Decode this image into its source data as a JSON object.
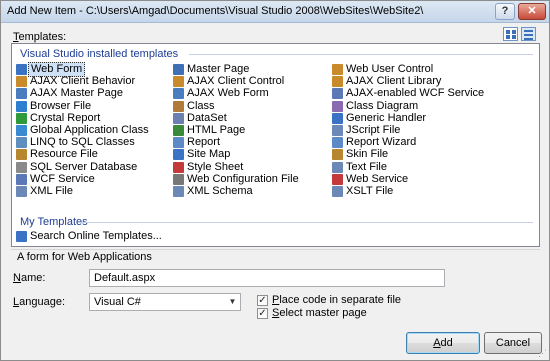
{
  "window": {
    "title": "Add New Item - C:\\Users\\Amgad\\Documents\\Visual Studio 2008\\WebSites\\WebSite2\\"
  },
  "title_buttons": {
    "help": "?",
    "close": "✕"
  },
  "templates_label_prefix": "T",
  "templates_label_rest": "emplates:",
  "groups": {
    "installed": "Visual Studio installed templates",
    "my": "My Templates"
  },
  "installed_templates": [
    {
      "label": "Web Form",
      "icon": "web-form-icon",
      "color": "#3a72c4",
      "selected": true
    },
    {
      "label": "AJAX Client Behavior",
      "icon": "ajax-behavior-icon",
      "color": "#c98a2b"
    },
    {
      "label": "AJAX Master Page",
      "icon": "ajax-master-page-icon",
      "color": "#4a7cc0"
    },
    {
      "label": "Browser File",
      "icon": "browser-file-icon",
      "color": "#2f7fd0"
    },
    {
      "label": "Crystal Report",
      "icon": "crystal-report-icon",
      "color": "#2f9a3a"
    },
    {
      "label": "Global Application Class",
      "icon": "global-class-icon",
      "color": "#3a8ad1"
    },
    {
      "label": "LINQ to SQL Classes",
      "icon": "linq-icon",
      "color": "#5e8fbe"
    },
    {
      "label": "Resource File",
      "icon": "resource-file-icon",
      "color": "#b8862f"
    },
    {
      "label": "SQL Server Database",
      "icon": "database-icon",
      "color": "#8a8a8a"
    },
    {
      "label": "WCF Service",
      "icon": "wcf-service-icon",
      "color": "#5b79b6"
    },
    {
      "label": "XML File",
      "icon": "xml-file-icon",
      "color": "#6b88b6"
    },
    {
      "label": "Master Page",
      "icon": "master-page-icon",
      "color": "#3f6fb4"
    },
    {
      "label": "AJAX Client Control",
      "icon": "ajax-control-icon",
      "color": "#c98a2b"
    },
    {
      "label": "AJAX Web Form",
      "icon": "ajax-web-form-icon",
      "color": "#4a7cc0"
    },
    {
      "label": "Class",
      "icon": "class-icon",
      "color": "#b07a3a"
    },
    {
      "label": "DataSet",
      "icon": "dataset-icon",
      "color": "#6b7fb0"
    },
    {
      "label": "HTML Page",
      "icon": "html-page-icon",
      "color": "#3b8a3b"
    },
    {
      "label": "Report",
      "icon": "report-icon",
      "color": "#5b8ac6"
    },
    {
      "label": "Site Map",
      "icon": "site-map-icon",
      "color": "#3a72c4"
    },
    {
      "label": "Style Sheet",
      "icon": "style-sheet-icon",
      "color": "#c43a3a"
    },
    {
      "label": "Web Configuration File",
      "icon": "web-config-icon",
      "color": "#777777"
    },
    {
      "label": "XML Schema",
      "icon": "xml-schema-icon",
      "color": "#6b88b6"
    },
    {
      "label": "Web User Control",
      "icon": "user-control-icon",
      "color": "#c98a2b"
    },
    {
      "label": "AJAX Client Library",
      "icon": "ajax-library-icon",
      "color": "#c98a2b"
    },
    {
      "label": "AJAX-enabled WCF Service",
      "icon": "ajax-wcf-icon",
      "color": "#5b79b6"
    },
    {
      "label": "Class Diagram",
      "icon": "class-diagram-icon",
      "color": "#8a6ab0"
    },
    {
      "label": "Generic Handler",
      "icon": "generic-handler-icon",
      "color": "#3a72c4"
    },
    {
      "label": "JScript File",
      "icon": "jscript-file-icon",
      "color": "#6b88b6"
    },
    {
      "label": "Report Wizard",
      "icon": "report-wizard-icon",
      "color": "#5b8ac6"
    },
    {
      "label": "Skin File",
      "icon": "skin-file-icon",
      "color": "#b8862f"
    },
    {
      "label": "Text File",
      "icon": "text-file-icon",
      "color": "#6b88b6"
    },
    {
      "label": "Web Service",
      "icon": "web-service-icon",
      "color": "#c43a3a"
    },
    {
      "label": "XSLT File",
      "icon": "xslt-file-icon",
      "color": "#6b88b6"
    }
  ],
  "my_templates": [
    {
      "label": "Search Online Templates...",
      "icon": "search-online-icon",
      "color": "#3a72c4"
    }
  ],
  "description": "A form for Web Applications",
  "name_field": {
    "label_prefix": "N",
    "label_rest": "ame:",
    "value": "Default.aspx"
  },
  "language_field": {
    "label_prefix": "L",
    "label_rest": "anguage:",
    "value": "Visual C#",
    "arrow": "▼"
  },
  "options": [
    {
      "prefix": "P",
      "rest": "lace code in separate file",
      "checked": true
    },
    {
      "prefix": "S",
      "rest": "elect master page",
      "checked": true
    }
  ],
  "check_mark": "✓",
  "buttons": {
    "add_prefix": "A",
    "add_rest": "dd",
    "cancel": "Cancel"
  },
  "resize_grip": "⋰"
}
